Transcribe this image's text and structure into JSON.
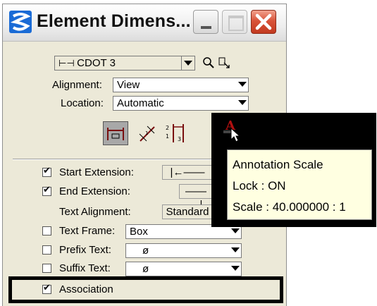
{
  "window": {
    "title": "Element Dimens...",
    "colors": {
      "title_bg": "#eeeeee",
      "body_bg": "#ece9d8",
      "close_red": "#d9543a",
      "tooltip_bg": "#ffffe1"
    }
  },
  "style_row": {
    "style_value": "CDOT 3",
    "icons": [
      "search-icon",
      "match-icon"
    ]
  },
  "alignment": {
    "label": "Alignment:",
    "value": "View"
  },
  "location": {
    "label": "Location:",
    "value": "Automatic"
  },
  "tool_icons": [
    "dimension-horizontal-icon",
    "dimension-slant-icon",
    "dimension-stacked-icon",
    "annotation-scale-icon"
  ],
  "tooltip": {
    "line1": "Annotation Scale",
    "line2": "Lock  : ON",
    "line3": "Scale : 40.000000 : 1"
  },
  "options": {
    "start_extension": {
      "label": "Start Extension:",
      "checked": true,
      "value": "|←——"
    },
    "end_extension": {
      "label": "End Extension:",
      "checked": true,
      "value": "——→|"
    },
    "text_alignment": {
      "label": "Text Alignment:",
      "value": "Standard"
    },
    "text_frame": {
      "label": "Text Frame:",
      "checked": false,
      "value": "Box"
    },
    "prefix_text": {
      "label": "Prefix Text:",
      "checked": false,
      "value": "ø"
    },
    "suffix_text": {
      "label": "Suffix Text:",
      "checked": false,
      "value": "ø"
    },
    "association": {
      "label": "Association",
      "checked": true
    }
  }
}
